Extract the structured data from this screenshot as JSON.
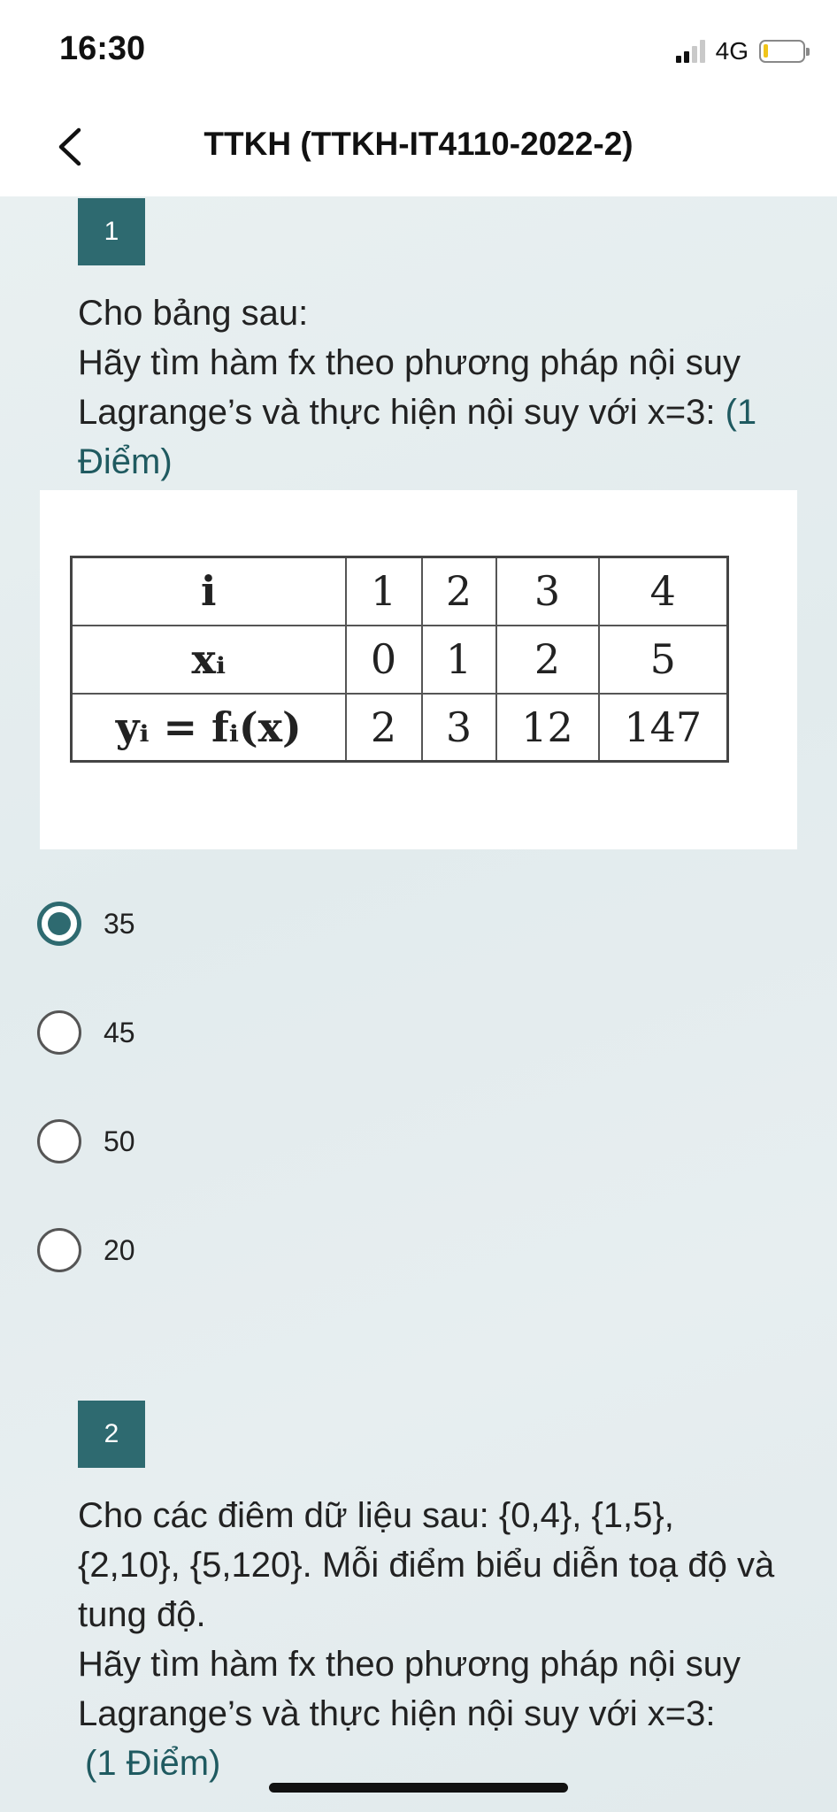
{
  "status": {
    "time": "16:30",
    "network": "4G"
  },
  "header": {
    "title": "TTKH (TTKH-IT4110-2022-2)"
  },
  "questions": [
    {
      "number": "1",
      "lines": [
        "Cho bảng sau:",
        "Hãy tìm hàm fx theo phương pháp nội suy Lagrange’s và thực hiện nội suy với x=3:"
      ],
      "points": "(1 Điểm)",
      "table": {
        "rows": [
          {
            "head": "i",
            "cells": [
              "1",
              "2",
              "3",
              "4"
            ]
          },
          {
            "head": "xᵢ",
            "cells": [
              "0",
              "1",
              "2",
              "5"
            ]
          },
          {
            "head": "yᵢ = fᵢ(x)",
            "cells": [
              "2",
              "3",
              "12",
              "147"
            ]
          }
        ]
      },
      "options": [
        {
          "label": "35",
          "selected": true
        },
        {
          "label": "45",
          "selected": false
        },
        {
          "label": "50",
          "selected": false
        },
        {
          "label": "20",
          "selected": false
        }
      ]
    },
    {
      "number": "2",
      "lines": [
        "Cho các điêm dữ liệu sau: {0,4}, {1,5}, {2,10}, {5,120}. Mỗi điểm biểu diễn toạ độ và tung độ.",
        "Hãy tìm hàm fx theo phương pháp nội suy Lagrange’s và thực hiện nội suy với x=3:"
      ],
      "points": "(1 Điểm)"
    }
  ],
  "colors": {
    "accent": "#2e6a70",
    "background": "#e6eef0"
  }
}
